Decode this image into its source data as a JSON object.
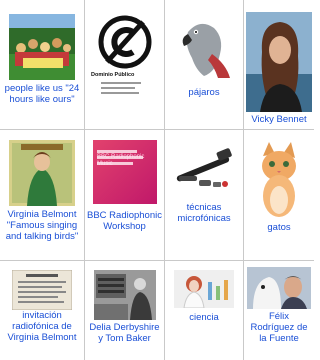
{
  "cells": [
    {
      "label": "people like us \"24 hours like ours\"",
      "icon": "album-cover-image"
    },
    {
      "label": "",
      "icon": "public-domain-logo",
      "logo_text": "Dominio Público"
    },
    {
      "label": "pájaros",
      "icon": "parrot-image"
    },
    {
      "label": "Vicky Bennet",
      "icon": "portrait-image"
    },
    {
      "label": "Virginia Belmont \"Famous singing and talking birds\"",
      "icon": "record-cover-image"
    },
    {
      "label": "BBC Radiophonic Workshop",
      "icon": "bbc-cover-image",
      "cover_text": "BBC Radiophonic Music"
    },
    {
      "label": "técnicas microfónicas",
      "icon": "microphone-image"
    },
    {
      "label": "gatos",
      "icon": "kitten-image"
    },
    {
      "label": "invitación radiofónica de Virginia Belmont",
      "icon": "invitation-card-image"
    },
    {
      "label": "Delia Derbyshire y Tom Baker",
      "icon": "studio-photo-image"
    },
    {
      "label": "ciencia",
      "icon": "science-image"
    },
    {
      "label": "Félix Rodríguez de la Fuente",
      "icon": "dog-man-image"
    }
  ],
  "colors": {
    "link": "#1a4fd6",
    "grid_line": "#c9c9c9"
  }
}
